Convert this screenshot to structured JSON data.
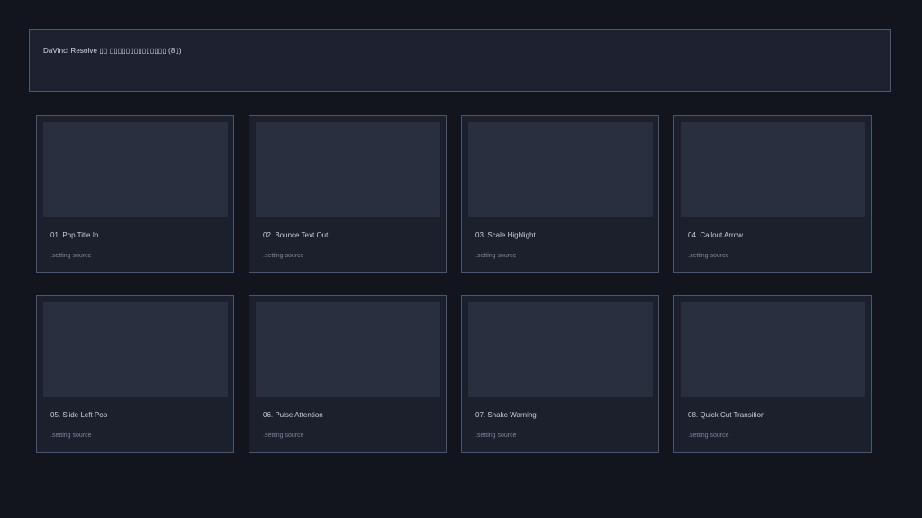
{
  "header": {
    "title": "DaVinci Resolve ▯▯ ▯▯▯▯▯▯▯▯▯▯▯▯▯▯ (8▯)"
  },
  "cards": [
    {
      "title": "01. Pop Title In",
      "subtitle": ".setting source"
    },
    {
      "title": "02. Bounce Text Out",
      "subtitle": ".setting source"
    },
    {
      "title": "03. Scale Highlight",
      "subtitle": ".setting source"
    },
    {
      "title": "04. Callout Arrow",
      "subtitle": ".setting source"
    },
    {
      "title": "05. Slide Left Pop",
      "subtitle": ".setting source"
    },
    {
      "title": "06. Pulse Attention",
      "subtitle": ".setting source"
    },
    {
      "title": "07. Shake Warning",
      "subtitle": ".setting source"
    },
    {
      "title": "08. Quick Cut Transition",
      "subtitle": ".setting source"
    }
  ]
}
